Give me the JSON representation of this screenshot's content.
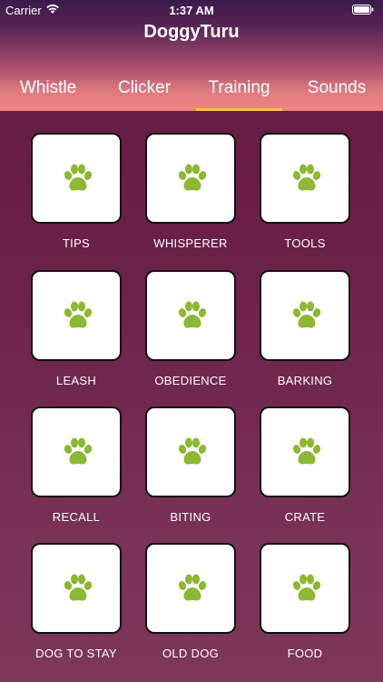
{
  "status_bar": {
    "carrier": "Carrier",
    "time": "1:37 AM",
    "wifi_icon": "wifi-icon",
    "battery_icon": "battery-icon"
  },
  "app": {
    "title": "DoggyTuru"
  },
  "tabs": [
    {
      "label": "Whistle",
      "selected": false
    },
    {
      "label": "Clicker",
      "selected": false
    },
    {
      "label": "Training",
      "selected": true
    },
    {
      "label": "Sounds",
      "selected": false
    }
  ],
  "colors": {
    "accent_underline": "#f3c53d",
    "paw_green": "#8cb832",
    "background": "#6c1e45"
  },
  "tiles": [
    {
      "label": "TIPS",
      "icon": "paw-icon"
    },
    {
      "label": "WHISPERER",
      "icon": "paw-icon"
    },
    {
      "label": "TOOLS",
      "icon": "paw-icon"
    },
    {
      "label": "LEASH",
      "icon": "paw-icon"
    },
    {
      "label": "OBEDIENCE",
      "icon": "paw-icon"
    },
    {
      "label": "BARKING",
      "icon": "paw-icon"
    },
    {
      "label": "RECALL",
      "icon": "paw-icon"
    },
    {
      "label": "BITING",
      "icon": "paw-icon"
    },
    {
      "label": "CRATE",
      "icon": "paw-icon"
    },
    {
      "label": "DOG TO STAY",
      "icon": "paw-icon"
    },
    {
      "label": "OLD DOG",
      "icon": "paw-icon"
    },
    {
      "label": "FOOD",
      "icon": "paw-icon"
    }
  ]
}
